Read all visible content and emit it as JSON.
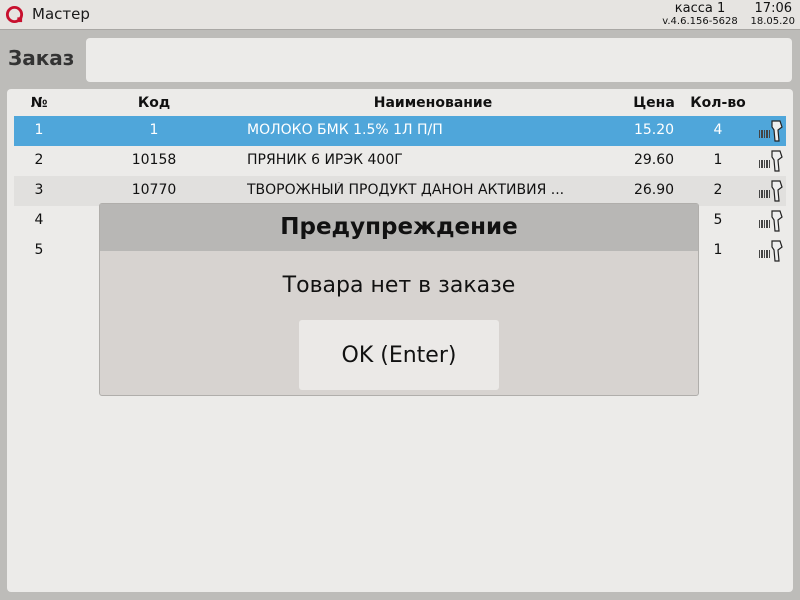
{
  "app": {
    "title": "Мастер",
    "register": "касса 1",
    "version": "v.4.6.156-5628",
    "time": "17:06",
    "date": "18.05.20"
  },
  "order": {
    "label": "Заказ",
    "input_value": ""
  },
  "table": {
    "headers": {
      "num": "№",
      "code": "Код",
      "name": "Наименование",
      "price": "Цена",
      "qty": "Кол-во"
    },
    "rows": [
      {
        "num": "1",
        "code": "1",
        "name": "МОЛОКО БМК 1.5% 1Л П/П",
        "price": "15.20",
        "qty": "4",
        "selected": true
      },
      {
        "num": "2",
        "code": "10158",
        "name": "ПРЯНИК 6 ИРЭК 400Г",
        "price": "29.60",
        "qty": "1"
      },
      {
        "num": "3",
        "code": "10770",
        "name": "ТВОРОЖНЫЙ ПРОДУКТ ДАНОН АКТИВИЯ ...",
        "price": "26.90",
        "qty": "2"
      },
      {
        "num": "4",
        "code": "",
        "name": "",
        "price": "",
        "qty": "5"
      },
      {
        "num": "5",
        "code": "",
        "name": "",
        "price": "",
        "qty": "1"
      }
    ],
    "row_icon": "barcode-scanner-icon"
  },
  "dialog": {
    "title": "Предупреждение",
    "message": "Товара нет в заказе",
    "ok_label": "OK (Enter)"
  },
  "colors": {
    "accent": "#4fa6da",
    "brand": "#c8102e",
    "background": "#bdbcb9",
    "panel": "#ecebe9"
  }
}
